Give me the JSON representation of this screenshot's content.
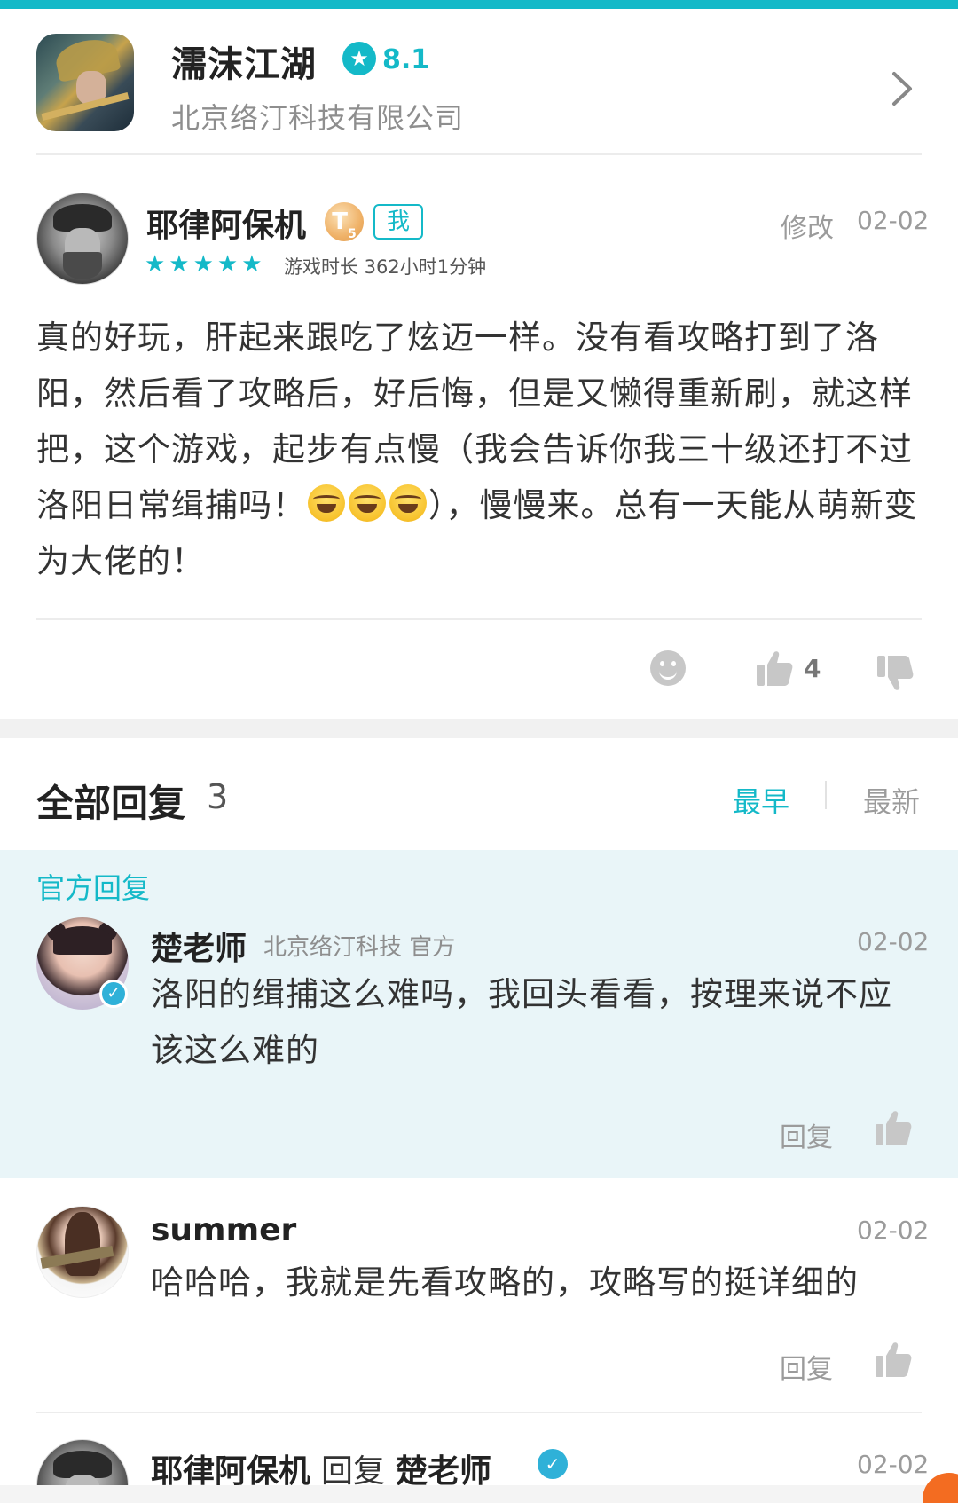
{
  "game": {
    "title": "濡沫江湖",
    "rating": "8.1",
    "publisher": "北京络汀科技有限公司"
  },
  "review": {
    "author": "耶律阿保机",
    "level_badge": "T",
    "level_sub": "5",
    "me_tag": "我",
    "edit_label": "修改",
    "date": "02-02",
    "stars": 5,
    "stars_text": "★★★★★",
    "playtime": "游戏时长 362小时1分钟",
    "body_part1": "真的好玩，肝起来跟吃了炫迈一样。没有看攻略打到了洛阳，然后看了攻略后，好后悔，但是又懒得重新刷，就这样把，这个游戏，起步有点慢（我会告诉你我三十级还打不过洛阳日常缉捕吗！",
    "body_part2": "），慢慢来。总有一天能从萌新变为大佬的！",
    "emoji_count": 3,
    "like_count": "4"
  },
  "replies": {
    "title": "全部回复",
    "count": "3",
    "sort_earliest": "最早",
    "sort_latest": "最新",
    "official_label": "官方回复",
    "items": [
      {
        "author": "楚老师",
        "org": "北京络汀科技 官方",
        "date": "02-02",
        "body": "洛阳的缉捕这么难吗，我回头看看，按理来说不应该这么难的",
        "reply_label": "回复"
      },
      {
        "author": "summer",
        "date": "02-02",
        "body": "哈哈哈，我就是先看攻略的，攻略写的挺详细的",
        "reply_label": "回复"
      },
      {
        "author": "耶律阿保机",
        "mid": "回复",
        "target": "楚老师",
        "date": "02-02"
      }
    ]
  },
  "colors": {
    "accent": "#14b9c8",
    "official_bg": "#e9f5f8",
    "muted": "#9b9b9b"
  },
  "icons": {
    "chevron": "chevron-right-icon",
    "smile": "emoji-smile-icon",
    "like": "thumbs-up-icon",
    "dislike": "thumbs-down-icon",
    "verified": "verified-check-icon",
    "rating_star": "star-icon"
  }
}
